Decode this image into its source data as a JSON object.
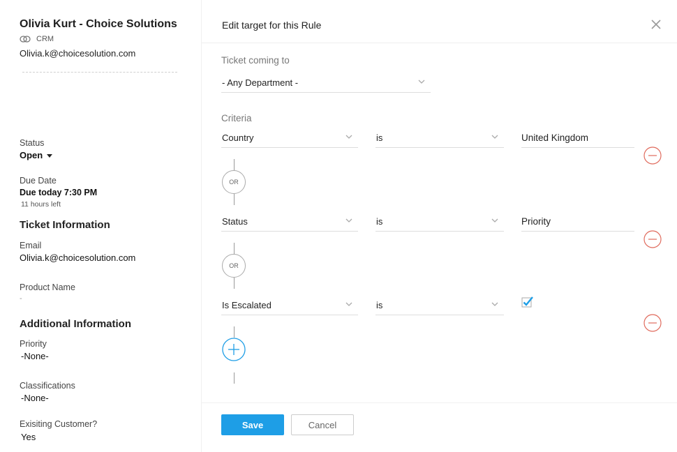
{
  "contact": {
    "name": "Olivia Kurt - Choice Solutions",
    "source": "CRM",
    "email": "Olivia.k@choicesolution.com"
  },
  "ticket": {
    "status_label": "Status",
    "status_value": "Open",
    "due_label": "Due Date",
    "due_value": "Due today 7:30 PM",
    "due_note": "11 hours left",
    "section_ticket_info": "Ticket Information",
    "email_label": "Email",
    "email_value": "Olivia.k@choicesolution.com",
    "product_label": "Product Name",
    "product_value": "-",
    "section_additional": "Additional Information",
    "priority_label": "Priority",
    "priority_value": "-None-",
    "classifications_label": "Classifications",
    "classifications_value": "-None-",
    "existing_label": "Exisiting Customer?",
    "existing_value": "Yes"
  },
  "dialog": {
    "title": "Edit target for this Rule",
    "ticket_coming_label": "Ticket coming to",
    "department_value": "- Any Department -",
    "criteria_label": "Criteria",
    "connector_label": "OR",
    "criteria": [
      {
        "field": "Country",
        "operator": "is",
        "value": "United Kingdom"
      },
      {
        "field": "Status",
        "operator": "is",
        "value": "Priority"
      },
      {
        "field": "Is Escalated",
        "operator": "is",
        "value_checked": true
      }
    ],
    "save_label": "Save",
    "cancel_label": "Cancel"
  },
  "colors": {
    "accent": "#1e9ee6",
    "remove": "#e06a5c"
  }
}
